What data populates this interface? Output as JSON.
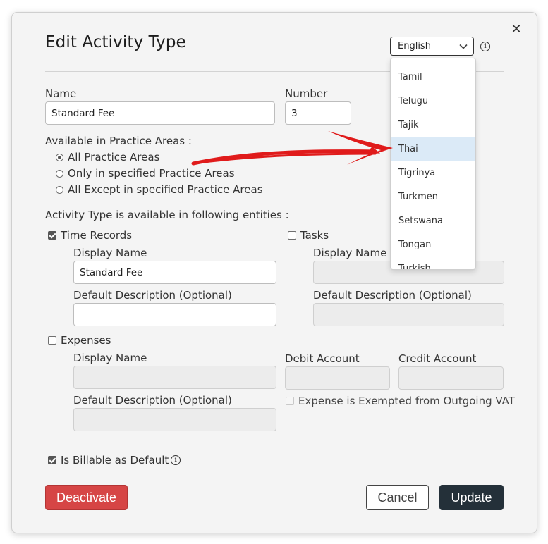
{
  "dialog": {
    "title": "Edit Activity Type",
    "close_icon": "✕"
  },
  "language": {
    "selected": "English",
    "options": [
      "Tamil",
      "Telugu",
      "Tajik",
      "Thai",
      "Tigrinya",
      "Turkmen",
      "Setswana",
      "Tongan",
      "Turkish"
    ],
    "highlighted": "Thai"
  },
  "fields": {
    "name_label": "Name",
    "name_value": "Standard Fee",
    "number_label": "Number",
    "number_value": "3"
  },
  "practice_areas": {
    "label": "Available in Practice Areas :",
    "options": [
      "All Practice Areas",
      "Only in specified Practice Areas",
      "All Except in specified Practice Areas"
    ],
    "selected_index": 0
  },
  "entities": {
    "label": "Activity Type is available in following entities :",
    "time_records": {
      "label": "Time Records",
      "checked": true,
      "display_name_label": "Display Name",
      "display_name_value": "Standard Fee",
      "default_desc_label": "Default Description (Optional)",
      "default_desc_value": ""
    },
    "tasks": {
      "label": "Tasks",
      "checked": false,
      "display_name_label": "Display Name",
      "default_desc_label": "Default Description (Optional)"
    },
    "expenses": {
      "label": "Expenses",
      "checked": false,
      "display_name_label": "Display Name",
      "debit_account_label": "Debit Account",
      "credit_account_label": "Credit Account",
      "default_desc_label": "Default Description (Optional)",
      "vat_label": "Expense is Exempted from Outgoing VAT"
    }
  },
  "billable": {
    "label": "Is Billable as Default",
    "checked": true
  },
  "buttons": {
    "deactivate": "Deactivate",
    "cancel": "Cancel",
    "update": "Update"
  },
  "colors": {
    "deactivate": "#d64545",
    "update": "#243039",
    "highlight": "#dbeaf7",
    "annotation_arrow": "#e01b1b"
  }
}
